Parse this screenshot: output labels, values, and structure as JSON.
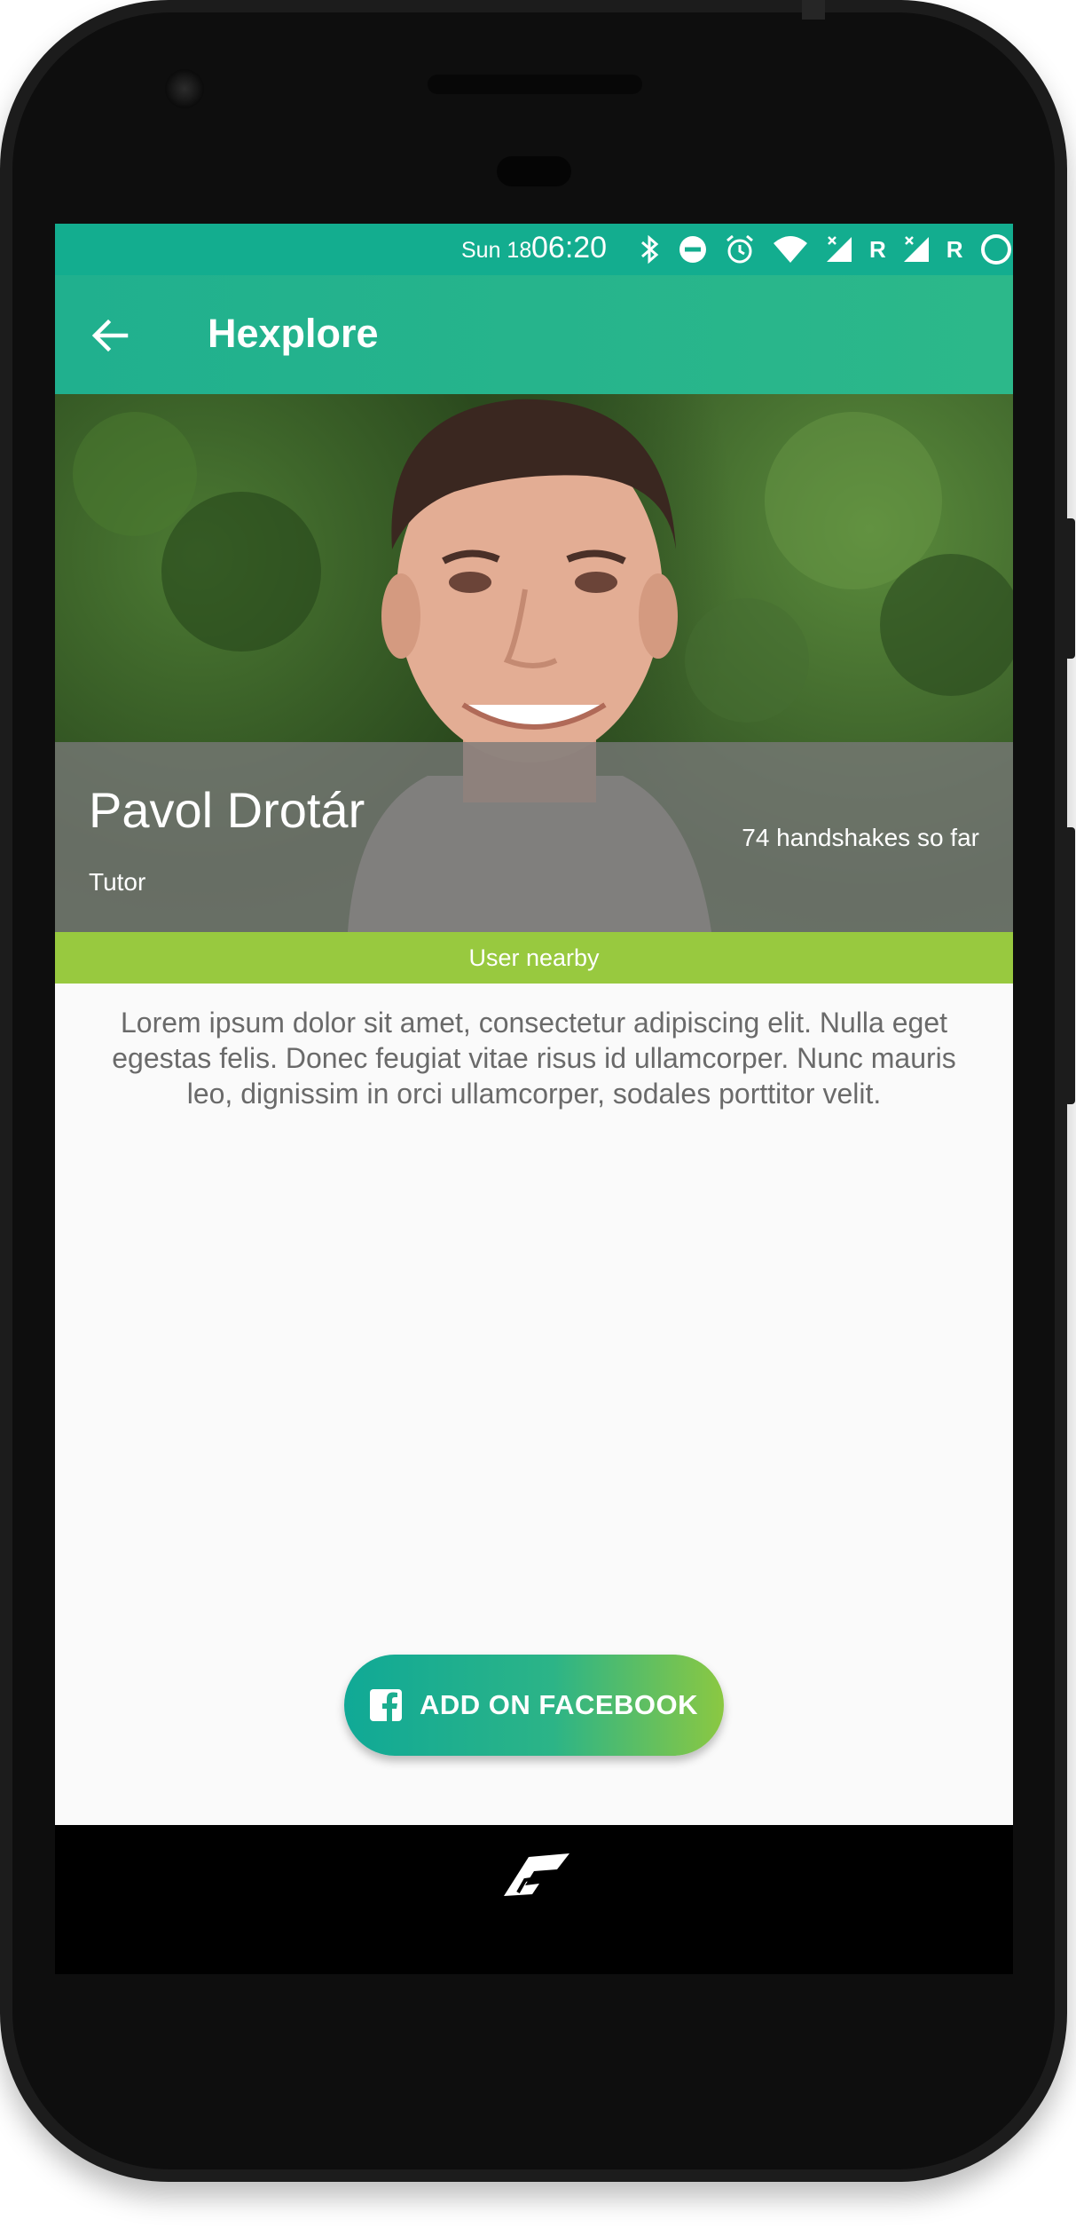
{
  "status_bar": {
    "date": "Sun 18",
    "time": "06:20",
    "roaming_1": "R",
    "roaming_2": "R"
  },
  "app_bar": {
    "title": "Hexplore",
    "back_icon": "arrow-left-icon"
  },
  "profile": {
    "name": "Pavol Drotár",
    "role": "Tutor",
    "handshakes": "74 handshakes so far",
    "nearby_label": "User nearby",
    "bio": "Lorem ipsum dolor sit amet, consectetur adipiscing elit. Nulla eget egestas felis. Donec feugiat vitae risus id ullamcorper. Nunc mauris leo, dignissim in orci ullamcorper, sodales porttitor velit."
  },
  "actions": {
    "facebook_label": "ADD ON FACEBOOK",
    "facebook_icon": "facebook-icon"
  },
  "colors": {
    "status_bar": "#13ad8f",
    "app_bar": "#24b38c",
    "nearby_bar": "#98c93f",
    "button_gradient_start": "#10a996",
    "button_gradient_end": "#8bc842"
  }
}
